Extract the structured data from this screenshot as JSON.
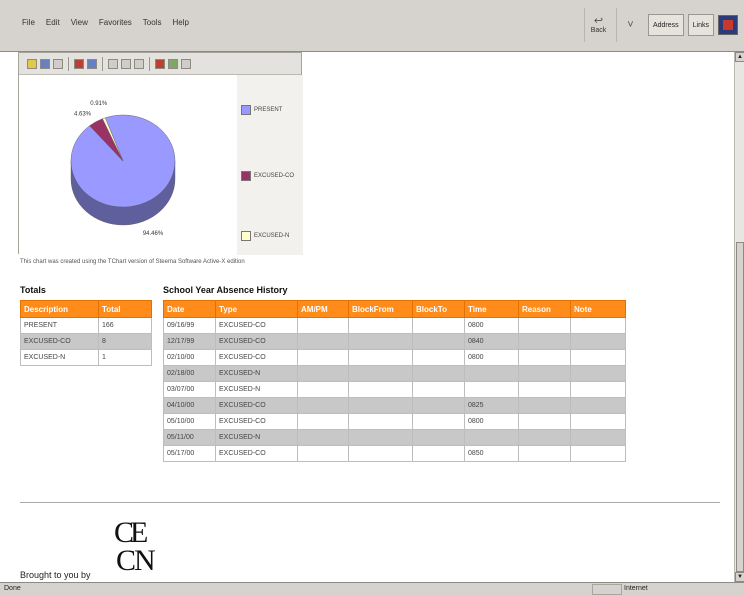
{
  "browser": {
    "menu": [
      "File",
      "Edit",
      "View",
      "Favorites",
      "Tools",
      "Help"
    ],
    "back_label": "Back",
    "address_label": "Address",
    "links_label": "Links",
    "status_text": "Done",
    "zone_text": "Internet"
  },
  "chart_data": {
    "type": "pie",
    "categories": [
      "PRESENT",
      "EXCUSED-CO",
      "EXCUSED-N"
    ],
    "values": [
      94.46,
      4.63,
      0.91
    ],
    "value_labels": [
      "94.46%",
      "4.63%",
      "0.91%"
    ],
    "colors": [
      "#9999ff",
      "#993366",
      "#ffffcc"
    ],
    "legend_position": "right"
  },
  "caption": "This chart was created using the TChart version of Steema Software Active-X edition",
  "totals": {
    "heading": "Totals",
    "headers": [
      "Description",
      "Total"
    ],
    "rows": [
      [
        "PRESENT",
        "166"
      ],
      [
        "EXCUSED-CO",
        "8"
      ],
      [
        "EXCUSED-N",
        "1"
      ]
    ]
  },
  "history": {
    "heading": "School Year Absence History",
    "headers": [
      "Date",
      "Type",
      "AM/PM",
      "BlockFrom",
      "BlockTo",
      "Time",
      "Reason",
      "Note"
    ],
    "rows": [
      [
        "09/16/99",
        "EXCUSED-CO",
        "",
        "",
        "",
        "0800",
        "",
        ""
      ],
      [
        "12/17/99",
        "EXCUSED-CO",
        "",
        "",
        "",
        "0840",
        "",
        ""
      ],
      [
        "02/10/00",
        "EXCUSED-CO",
        "",
        "",
        "",
        "0800",
        "",
        ""
      ],
      [
        "02/18/00",
        "EXCUSED-N",
        "",
        "",
        "",
        "",
        "",
        ""
      ],
      [
        "03/07/00",
        "EXCUSED-N",
        "",
        "",
        "",
        "",
        "",
        ""
      ],
      [
        "04/10/00",
        "EXCUSED-CO",
        "",
        "",
        "",
        "0825",
        "",
        ""
      ],
      [
        "05/10/00",
        "EXCUSED-CO",
        "",
        "",
        "",
        "0800",
        "",
        ""
      ],
      [
        "05/11/00",
        "EXCUSED-N",
        "",
        "",
        "",
        "",
        "",
        ""
      ],
      [
        "05/17/00",
        "EXCUSED-CO",
        "",
        "",
        "",
        "0850",
        "",
        ""
      ]
    ]
  },
  "footer": {
    "brought_by": "Brought to you by",
    "logo_letters": "CEEN"
  }
}
